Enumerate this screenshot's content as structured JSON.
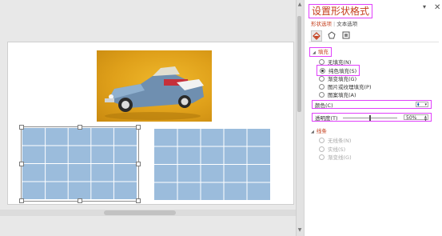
{
  "pane": {
    "title": "设置形状格式",
    "tabs": [
      {
        "label": "形状选项",
        "active": true
      },
      {
        "label": "文本选项",
        "active": false
      }
    ],
    "icons": [
      {
        "name": "fill-line-icon",
        "active": true
      },
      {
        "name": "effects-icon",
        "active": false
      },
      {
        "name": "size-properties-icon",
        "active": false
      }
    ],
    "fill": {
      "header": "填充",
      "options": [
        {
          "label": "无填充(N)",
          "checked": false
        },
        {
          "label": "纯色填充(S)",
          "checked": true
        },
        {
          "label": "渐变填充(G)",
          "checked": false
        },
        {
          "label": "图片或纹理填充(P)",
          "checked": false
        },
        {
          "label": "图案填充(A)",
          "checked": false
        }
      ],
      "color_label": "颜色(C)",
      "transparency_label": "透明度(T)",
      "transparency_value": "50%",
      "transparency_fraction": 0.5
    },
    "line": {
      "header": "线条",
      "options": [
        {
          "label": "无线条(N)",
          "checked": true
        },
        {
          "label": "实线(S)",
          "checked": false
        },
        {
          "label": "渐变线(G)",
          "checked": false
        }
      ]
    }
  },
  "colors": {
    "accent": "#c43e1c",
    "highlight": "#e040fb",
    "table_fill": "#9bbcdc",
    "photo_bg": "#e0a418"
  }
}
